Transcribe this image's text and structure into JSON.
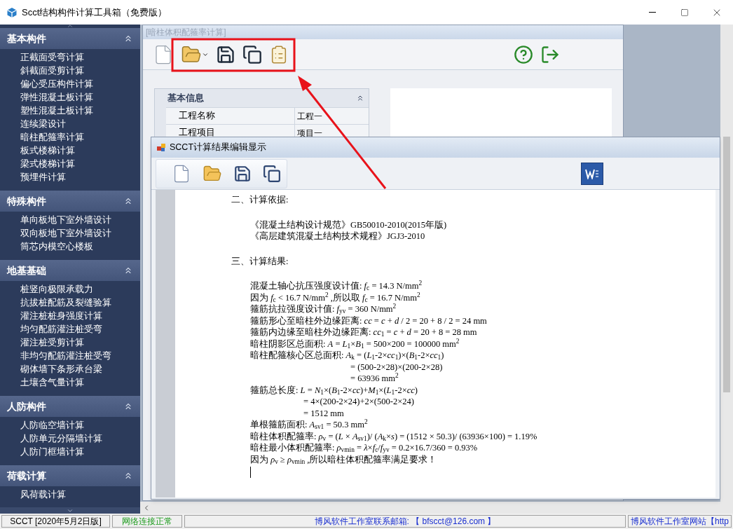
{
  "window": {
    "title": "Scct结构构件计算工具箱（免费版）"
  },
  "sidebar": {
    "sections": [
      {
        "title": "基本构件",
        "expanded": true,
        "items": [
          "正截面受弯计算",
          "斜截面受剪计算",
          "偏心受压构件计算",
          "弹性混凝土板计算",
          "塑性混凝土板计算",
          "连续梁设计",
          "暗柱配箍率计算",
          "板式楼梯计算",
          "梁式楼梯计算",
          "预埋件计算"
        ]
      },
      {
        "title": "特殊构件",
        "expanded": true,
        "items": [
          "单向板地下室外墙设计",
          "双向板地下室外墙设计",
          "筒芯内模空心楼板"
        ]
      },
      {
        "title": "地基基础",
        "expanded": true,
        "items": [
          "桩竖向极限承载力",
          "抗拔桩配筋及裂缝验算",
          "灌注桩桩身强度计算",
          "均匀配筋灌注桩受弯",
          "灌注桩受剪计算",
          "非均匀配筋灌注桩受弯",
          "砌体墙下条形承台梁",
          "土壤含气量计算"
        ]
      },
      {
        "title": "人防构件",
        "expanded": true,
        "items": [
          "人防临空墙计算",
          "人防单元分隔墙计算",
          "人防门框墙计算"
        ]
      },
      {
        "title": "荷载计算",
        "expanded": true,
        "items": [
          "风荷载计算"
        ]
      }
    ]
  },
  "back_window": {
    "title": "[暗柱体积配箍率计算]",
    "info_panel": {
      "title": "基本信息",
      "expanded": true,
      "rows": [
        {
          "label": "工程名称",
          "value": "工程一"
        },
        {
          "label": "工程项目",
          "value": "项目一"
        }
      ]
    }
  },
  "dialog": {
    "title": "SCCT计算结果编辑显示",
    "document": [
      {
        "kind": "heading",
        "text": "二、计算依据:"
      },
      {
        "kind": "line",
        "text": "《混凝土结构设计规范》GB50010-2010(2015年版)"
      },
      {
        "kind": "line",
        "text": "《高层建筑混凝土结构技术规程》JGJ3-2010"
      },
      {
        "kind": "heading",
        "text": "三、计算结果:"
      },
      {
        "kind": "line",
        "text": "混凝土轴心抗压强度设计值: *f*$_{c}$ = 14.3 N/mm$^{2}$"
      },
      {
        "kind": "line",
        "text": "因为 *f*$_{c}$ < 16.7 N/mm$^{2}$ ,所以取 *f*$_{c}$ = 16.7 N/mm$^{2}$"
      },
      {
        "kind": "line",
        "text": "箍筋抗拉强度设计值: *f*$_{yv}$ = 360 N/mm$^{2}$"
      },
      {
        "kind": "line",
        "text": "箍筋形心至暗柱外边缘距离: *cc* = *c* + *d* / 2 = 20 + 8 / 2 = 24 mm"
      },
      {
        "kind": "line",
        "text": "箍筋内边缘至暗柱外边缘距离: *cc*$_{1}$ = *c* + *d* = 20 + 8 = 28 mm"
      },
      {
        "kind": "line",
        "text": "暗柱阴影区总面积: *A* = *L*$_{1}$×*B*$_{1}$ = 500×200 = 100000 mm$^{2}$"
      },
      {
        "kind": "line",
        "text": "暗柱配箍核心区总面积: *A*$_{k}$ = (*L*$_{1}$-2×*cc*$_{1}$)×(*B*$_{1}$-2×*cc*$_{1}$)"
      },
      {
        "kind": "continuation",
        "text": "= (500-2×28)×(200-2×28)"
      },
      {
        "kind": "continuation",
        "text": "= 63936 mm$^{2}$"
      },
      {
        "kind": "line",
        "text": "箍筋总长度: *L* = *N*$_{1}$×(*B*$_{1}$-2×*cc*)+*M*$_{1}$×(*L*$_{1}$-2×*cc*)"
      },
      {
        "kind": "subline",
        "text": "= 4×(200-2×24)+2×(500-2×24)"
      },
      {
        "kind": "subline",
        "text": "= 1512 mm"
      },
      {
        "kind": "line",
        "text": "单根箍筋面积: *A*$_{sv1}$ = 50.3 mm$^{2}$"
      },
      {
        "kind": "line",
        "text": "暗柱体积配箍率: *ρ*$_{v}$ = (*L* × *A*$_{sv1}$)/ (*A*$_{k}$×*s*) = (1512 × 50.3)/ (63936×100) = 1.19%"
      },
      {
        "kind": "line",
        "text": "暗柱最小体积配箍率: *ρ*$_{vmin}$ = *λ*×*f*$_{c}$/*f*$_{yv}$ = 0.2×16.7/360 = 0.93%"
      },
      {
        "kind": "line",
        "text": "因为 *ρ*$_{v}$ ≥ *ρ*$_{vmin}$ ,所以暗柱体积配箍率满足要求！"
      }
    ]
  },
  "status_bar": [
    {
      "kind": "plain",
      "text": "SCCT  [2020年5月2日版]"
    },
    {
      "kind": "status",
      "text": "网络连接正常"
    },
    {
      "kind": "link",
      "text": "博风软件工作室联系邮箱: 【 bfscct@126.com 】"
    },
    {
      "kind": "link",
      "text": "博风软件工作室网站【http"
    }
  ]
}
